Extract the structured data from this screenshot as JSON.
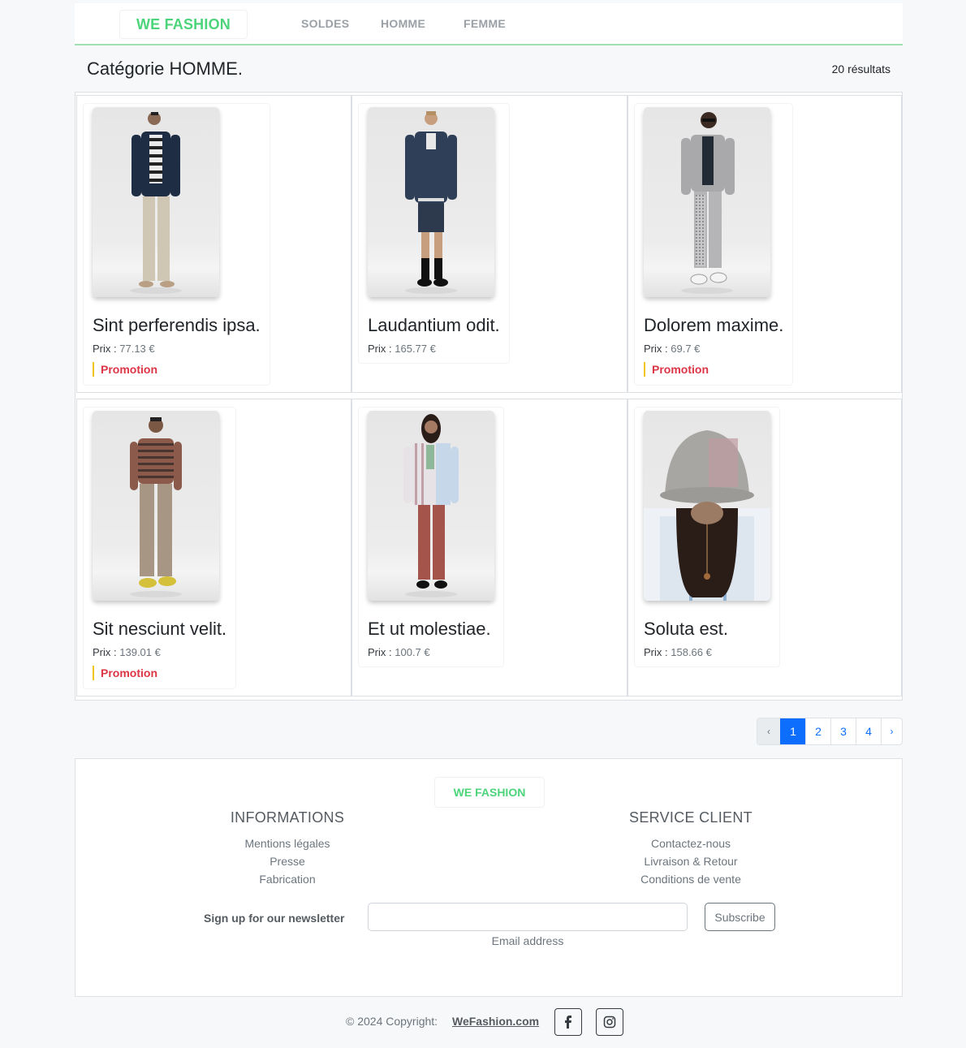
{
  "nav": {
    "brand": "WE FASHION",
    "links": [
      "SOLDES",
      "HOMME",
      "FEMME"
    ]
  },
  "category": {
    "title": "Catégorie HOMME.",
    "count": "20 résultats"
  },
  "products": [
    {
      "name": "Sint perferendis ipsa.",
      "price_label": "Prix :",
      "price": "77.13 €",
      "promo": "Promotion"
    },
    {
      "name": "Laudantium odit.",
      "price_label": "Prix :",
      "price": "165.77 €",
      "promo": ""
    },
    {
      "name": "Dolorem maxime.",
      "price_label": "Prix :",
      "price": "69.7 €",
      "promo": "Promotion"
    },
    {
      "name": "Sit nesciunt velit.",
      "price_label": "Prix :",
      "price": "139.01 €",
      "promo": "Promotion"
    },
    {
      "name": "Et ut molestiae.",
      "price_label": "Prix :",
      "price": "100.7 €",
      "promo": ""
    },
    {
      "name": "Soluta est.",
      "price_label": "Prix :",
      "price": "158.66 €",
      "promo": ""
    }
  ],
  "pagination": {
    "prev": "‹",
    "pages": [
      "1",
      "2",
      "3",
      "4"
    ],
    "active": "1",
    "next": "›"
  },
  "footer": {
    "brand": "WE FASHION",
    "informations": {
      "title": "INFORMATIONS",
      "links": [
        "Mentions légales",
        "Presse",
        "Fabrication"
      ]
    },
    "service": {
      "title": "SERVICE CLIENT",
      "links": [
        "Contactez-nous",
        "Livraison & Retour",
        "Conditions de vente"
      ]
    },
    "newsletter": {
      "label": "Sign up for our newsletter",
      "help": "Email address",
      "button": "Subscribe"
    }
  },
  "copyright": {
    "text": "© 2024 Copyright:",
    "link": "WeFashion.com",
    "social": [
      "facebook-icon",
      "instagram-icon"
    ]
  },
  "colors": {
    "brand": "#4cd47a",
    "promo": "#dc3545",
    "promo_bar": "#f1c40f",
    "primary": "#0d6efd"
  }
}
